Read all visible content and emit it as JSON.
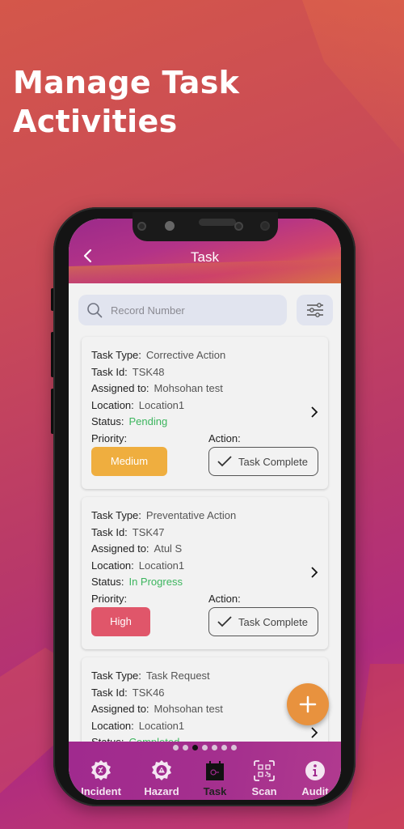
{
  "headline": {
    "line1": "Manage Task",
    "line2": "Activities"
  },
  "appbar": {
    "title": "Task",
    "back_icon": "chevron-left-icon"
  },
  "search": {
    "placeholder": "Record Number",
    "value": "",
    "icon": "search-icon",
    "filter_icon": "sliders-icon"
  },
  "labels": {
    "task_type": "Task Type:",
    "task_id": "Task Id:",
    "assigned_to": "Assigned to:",
    "location": "Location:",
    "status": "Status:",
    "priority": "Priority:",
    "action": "Action:"
  },
  "tasks": [
    {
      "task_type": "Corrective Action",
      "task_id": "TSK48",
      "assigned_to": "Mohsohan test",
      "location": "Location1",
      "status": "Pending",
      "priority": "Medium",
      "priority_color": "#efae3f",
      "action": "Task Complete"
    },
    {
      "task_type": "Preventative Action",
      "task_id": "TSK47",
      "assigned_to": "Atul S",
      "location": "Location1",
      "status": "In Progress",
      "priority": "High",
      "priority_color": "#e0566a",
      "action": "Task Complete"
    },
    {
      "task_type": "Task Request",
      "task_id": "TSK46",
      "assigned_to": "Mohsohan test",
      "location": "Location1",
      "status": "Completed"
    }
  ],
  "fab": {
    "icon": "plus-icon",
    "color": "#e8923e"
  },
  "pager": {
    "count": 7,
    "active_index": 2
  },
  "bottom_nav": [
    {
      "label": "Incident",
      "icon": "incident-gear-icon",
      "active": false
    },
    {
      "label": "Hazard",
      "icon": "hazard-gear-icon",
      "active": false
    },
    {
      "label": "Task",
      "icon": "task-calendar-icon",
      "active": true
    },
    {
      "label": "Scan",
      "icon": "qr-scan-icon",
      "active": false
    },
    {
      "label": "Audit",
      "icon": "info-icon",
      "active": false
    }
  ],
  "colors": {
    "status_green": "#3cb55e",
    "nav_bg": "#a02a8e"
  }
}
